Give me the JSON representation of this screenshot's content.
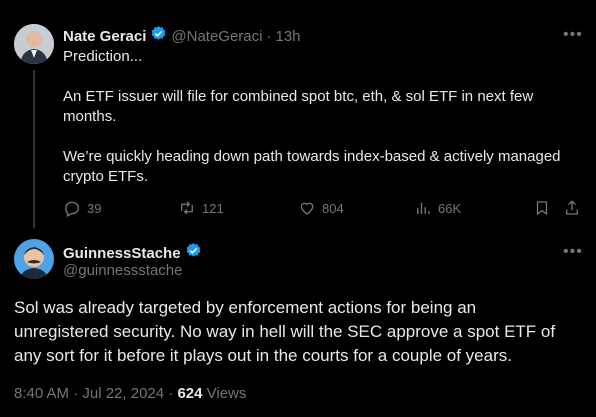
{
  "tweet": {
    "author_name": "Nate Geraci",
    "handle": "@NateGeraci",
    "separator": "·",
    "time": "13h",
    "lines": [
      "Prediction...",
      "",
      "An ETF issuer will file for combined spot btc, eth, & sol ETF in next few",
      "months.",
      "",
      "We’re quickly heading down path towards index-based & actively managed",
      "crypto ETFs."
    ],
    "actions": {
      "replies": "39",
      "reposts": "121",
      "likes": "804",
      "views": "66K"
    }
  },
  "reply": {
    "author_name": "GuinnessStache",
    "handle": "@guinnessstache",
    "lines": [
      "Sol was already targeted by enforcement actions for being an",
      "unregistered security. No way in hell  will the SEC approve a spot  ETF of",
      "any sort for it before it plays out in the courts for a couple of years."
    ],
    "time": "8:40 AM · Jul 22, 2024 · ",
    "views_count": "624",
    "views_label": " Views"
  },
  "icons": {
    "more": "more-icon",
    "verified": "verified-badge-icon",
    "reply": "reply-icon",
    "repost": "repost-icon",
    "like": "heart-icon",
    "views": "views-icon",
    "bookmark": "bookmark-icon",
    "share": "share-icon"
  },
  "colors": {
    "verified": "#1d9bf0",
    "muted": "#71767b",
    "text": "#e7e9ea",
    "background": "#000000"
  }
}
